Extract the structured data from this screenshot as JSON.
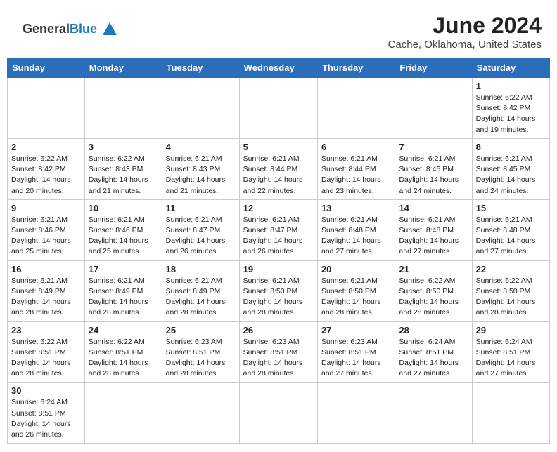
{
  "logo": {
    "line1": "General",
    "line2": "Blue"
  },
  "header": {
    "title": "June 2024",
    "subtitle": "Cache, Oklahoma, United States"
  },
  "weekdays": [
    "Sunday",
    "Monday",
    "Tuesday",
    "Wednesday",
    "Thursday",
    "Friday",
    "Saturday"
  ],
  "weeks": [
    [
      {
        "num": "",
        "info": ""
      },
      {
        "num": "",
        "info": ""
      },
      {
        "num": "",
        "info": ""
      },
      {
        "num": "",
        "info": ""
      },
      {
        "num": "",
        "info": ""
      },
      {
        "num": "",
        "info": ""
      },
      {
        "num": "1",
        "info": "Sunrise: 6:22 AM\nSunset: 8:42 PM\nDaylight: 14 hours\nand 19 minutes."
      }
    ],
    [
      {
        "num": "2",
        "info": "Sunrise: 6:22 AM\nSunset: 8:42 PM\nDaylight: 14 hours\nand 20 minutes."
      },
      {
        "num": "3",
        "info": "Sunrise: 6:22 AM\nSunset: 8:43 PM\nDaylight: 14 hours\nand 21 minutes."
      },
      {
        "num": "4",
        "info": "Sunrise: 6:21 AM\nSunset: 8:43 PM\nDaylight: 14 hours\nand 21 minutes."
      },
      {
        "num": "5",
        "info": "Sunrise: 6:21 AM\nSunset: 8:44 PM\nDaylight: 14 hours\nand 22 minutes."
      },
      {
        "num": "6",
        "info": "Sunrise: 6:21 AM\nSunset: 8:44 PM\nDaylight: 14 hours\nand 23 minutes."
      },
      {
        "num": "7",
        "info": "Sunrise: 6:21 AM\nSunset: 8:45 PM\nDaylight: 14 hours\nand 24 minutes."
      },
      {
        "num": "8",
        "info": "Sunrise: 6:21 AM\nSunset: 8:45 PM\nDaylight: 14 hours\nand 24 minutes."
      }
    ],
    [
      {
        "num": "9",
        "info": "Sunrise: 6:21 AM\nSunset: 8:46 PM\nDaylight: 14 hours\nand 25 minutes."
      },
      {
        "num": "10",
        "info": "Sunrise: 6:21 AM\nSunset: 8:46 PM\nDaylight: 14 hours\nand 25 minutes."
      },
      {
        "num": "11",
        "info": "Sunrise: 6:21 AM\nSunset: 8:47 PM\nDaylight: 14 hours\nand 26 minutes."
      },
      {
        "num": "12",
        "info": "Sunrise: 6:21 AM\nSunset: 8:47 PM\nDaylight: 14 hours\nand 26 minutes."
      },
      {
        "num": "13",
        "info": "Sunrise: 6:21 AM\nSunset: 8:48 PM\nDaylight: 14 hours\nand 27 minutes."
      },
      {
        "num": "14",
        "info": "Sunrise: 6:21 AM\nSunset: 8:48 PM\nDaylight: 14 hours\nand 27 minutes."
      },
      {
        "num": "15",
        "info": "Sunrise: 6:21 AM\nSunset: 8:48 PM\nDaylight: 14 hours\nand 27 minutes."
      }
    ],
    [
      {
        "num": "16",
        "info": "Sunrise: 6:21 AM\nSunset: 8:49 PM\nDaylight: 14 hours\nand 28 minutes."
      },
      {
        "num": "17",
        "info": "Sunrise: 6:21 AM\nSunset: 8:49 PM\nDaylight: 14 hours\nand 28 minutes."
      },
      {
        "num": "18",
        "info": "Sunrise: 6:21 AM\nSunset: 8:49 PM\nDaylight: 14 hours\nand 28 minutes."
      },
      {
        "num": "19",
        "info": "Sunrise: 6:21 AM\nSunset: 8:50 PM\nDaylight: 14 hours\nand 28 minutes."
      },
      {
        "num": "20",
        "info": "Sunrise: 6:21 AM\nSunset: 8:50 PM\nDaylight: 14 hours\nand 28 minutes."
      },
      {
        "num": "21",
        "info": "Sunrise: 6:22 AM\nSunset: 8:50 PM\nDaylight: 14 hours\nand 28 minutes."
      },
      {
        "num": "22",
        "info": "Sunrise: 6:22 AM\nSunset: 8:50 PM\nDaylight: 14 hours\nand 28 minutes."
      }
    ],
    [
      {
        "num": "23",
        "info": "Sunrise: 6:22 AM\nSunset: 8:51 PM\nDaylight: 14 hours\nand 28 minutes."
      },
      {
        "num": "24",
        "info": "Sunrise: 6:22 AM\nSunset: 8:51 PM\nDaylight: 14 hours\nand 28 minutes."
      },
      {
        "num": "25",
        "info": "Sunrise: 6:23 AM\nSunset: 8:51 PM\nDaylight: 14 hours\nand 28 minutes."
      },
      {
        "num": "26",
        "info": "Sunrise: 6:23 AM\nSunset: 8:51 PM\nDaylight: 14 hours\nand 28 minutes."
      },
      {
        "num": "27",
        "info": "Sunrise: 6:23 AM\nSunset: 8:51 PM\nDaylight: 14 hours\nand 27 minutes."
      },
      {
        "num": "28",
        "info": "Sunrise: 6:24 AM\nSunset: 8:51 PM\nDaylight: 14 hours\nand 27 minutes."
      },
      {
        "num": "29",
        "info": "Sunrise: 6:24 AM\nSunset: 8:51 PM\nDaylight: 14 hours\nand 27 minutes."
      }
    ],
    [
      {
        "num": "30",
        "info": "Sunrise: 6:24 AM\nSunset: 8:51 PM\nDaylight: 14 hours\nand 26 minutes."
      },
      {
        "num": "",
        "info": ""
      },
      {
        "num": "",
        "info": ""
      },
      {
        "num": "",
        "info": ""
      },
      {
        "num": "",
        "info": ""
      },
      {
        "num": "",
        "info": ""
      },
      {
        "num": "",
        "info": ""
      }
    ]
  ]
}
